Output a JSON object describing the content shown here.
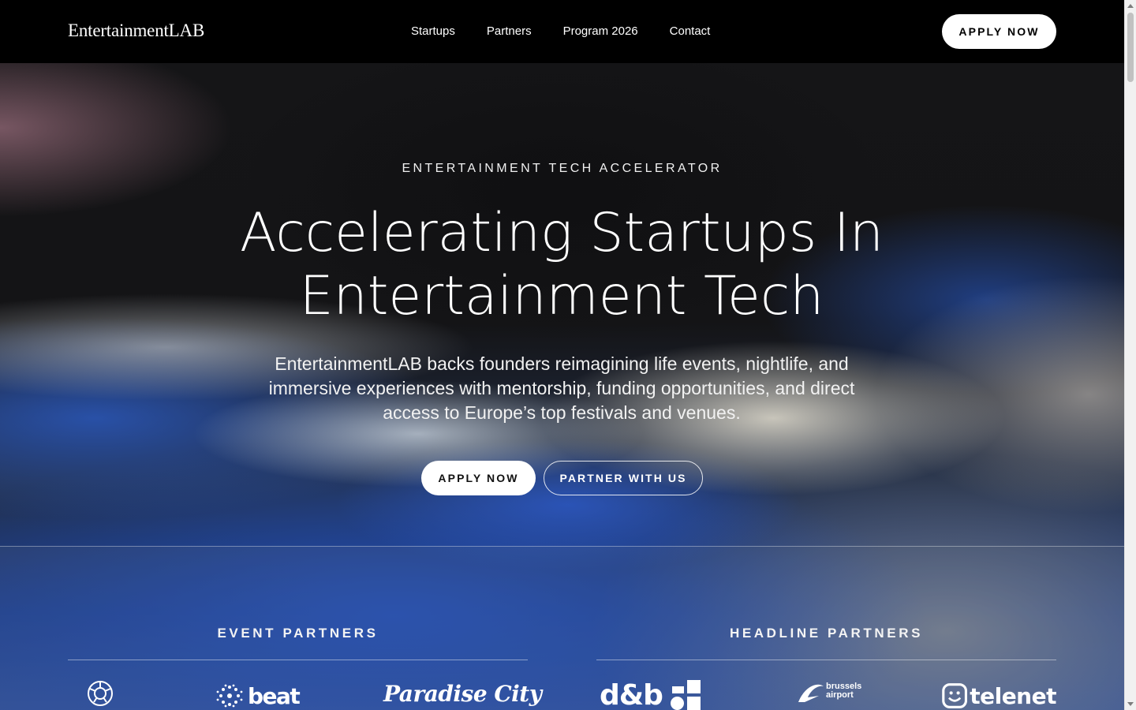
{
  "header": {
    "logo": "EntertainmentLAB",
    "nav": [
      {
        "label": "Startups"
      },
      {
        "label": "Partners"
      },
      {
        "label": "Program 2026"
      },
      {
        "label": "Contact"
      }
    ],
    "cta_label": "APPLY NOW"
  },
  "hero": {
    "eyebrow": "ENTERTAINMENT TECH ACCELERATOR",
    "title_line1": "Accelerating Startups In",
    "title_line2": "Entertainment Tech",
    "subtitle": "EntertainmentLAB backs founders reimagining life events, nightlife, and immersive experiences with mentorship, funding opportunities, and direct access to Europe’s top festivals and venues.",
    "apply_label": "APPLY NOW",
    "partner_label": "PARTNER WITH US"
  },
  "partners": {
    "event_heading": "EVENT PARTNERS",
    "headline_heading": "HEADLINE PARTNERS",
    "event_logos": [
      {
        "name": "tomorrowland-logo",
        "text": ""
      },
      {
        "name": "beat-logo",
        "text": "beat"
      },
      {
        "name": "paradise-city-logo",
        "text": "Paradise City"
      }
    ],
    "headline_logos": [
      {
        "name": "db-logo",
        "text": "d&b"
      },
      {
        "name": "brussels-airport-logo",
        "text": "brussels airport"
      },
      {
        "name": "telenet-logo",
        "text": "telenet"
      }
    ]
  },
  "colors": {
    "header_bg": "#000000",
    "button_bg": "#ffffff",
    "accent_blue": "#2d5fcd"
  }
}
